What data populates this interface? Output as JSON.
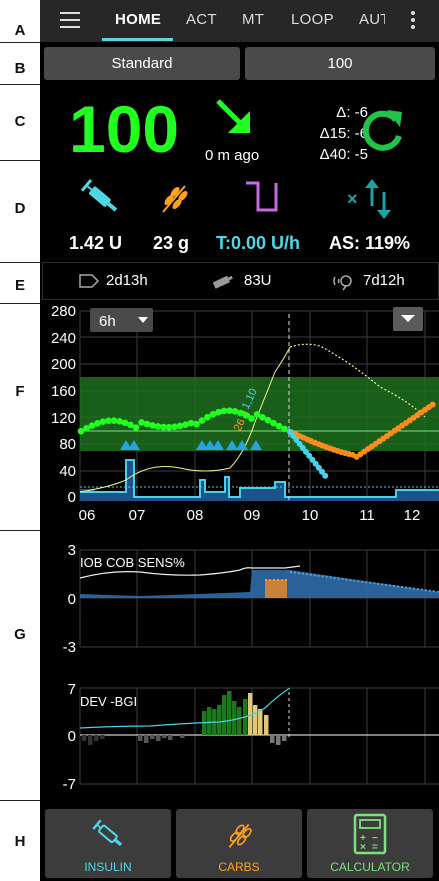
{
  "annotations": [
    "A",
    "B",
    "C",
    "D",
    "E",
    "F",
    "G",
    "H"
  ],
  "nav": {
    "tabs": [
      {
        "label": "HOME",
        "active": true
      },
      {
        "label": "ACT"
      },
      {
        "label": "MT"
      },
      {
        "label": "LOOP"
      },
      {
        "label": "AUT"
      }
    ],
    "menu_icon": "hamburger-icon",
    "overflow_icon": "more-vertical-icon"
  },
  "profile": {
    "name": "Standard",
    "target": "100"
  },
  "bg": {
    "value": "100",
    "trend_icon": "arrow-down-right-icon",
    "time_ago": "0 m ago",
    "delta": "Δ: -6",
    "delta15": "Δ15: -6",
    "delta40": "Δ40: -5",
    "refresh_icon": "refresh-icon",
    "color": "#21ff21"
  },
  "status": {
    "insulin": "1.42 U",
    "carbs": "23 g",
    "temp_basal": "T:0.00 U/h",
    "autosens": "AS: 119%",
    "icons": [
      "syringe-icon",
      "wheat-icon",
      "temp-basal-icon",
      "autosens-icon"
    ],
    "colors": {
      "insulin": "#4fd6e6",
      "carbs": "#ffa21a",
      "basal": "#c46be0",
      "autosens": "#19a5a5"
    }
  },
  "devices": {
    "cannula": "2d13h",
    "reservoir": "83U",
    "sensor": "7d12h"
  },
  "main_graph": {
    "range_label": "6h",
    "y_ticks": [
      "280",
      "240",
      "200",
      "160",
      "120",
      "80",
      "40",
      "0"
    ],
    "x_ticks": [
      "06",
      "07",
      "08",
      "09",
      "10",
      "11",
      "12"
    ],
    "annot_iob": "1,10",
    "annot_cob": "26 g"
  },
  "iob_graph": {
    "legend": "IOB COB SENS%",
    "y_ticks": [
      "3",
      "0",
      "-3"
    ]
  },
  "dev_graph": {
    "legend": "DEV -BGI",
    "y_ticks": [
      "7",
      "0",
      "-7"
    ]
  },
  "footer": {
    "insulin": "INSULIN",
    "carbs": "CARBS",
    "calculator": "CALCULATOR",
    "colors": {
      "insulin": "#4fd6e6",
      "carbs": "#ffa21a",
      "calculator": "#7ce07c"
    }
  },
  "chart_data": {
    "type": "line",
    "x": [
      "06:00",
      "06:30",
      "07:00",
      "07:30",
      "08:00",
      "08:30",
      "09:00",
      "09:30",
      "10:00",
      "10:30",
      "11:00",
      "11:30",
      "12:00"
    ],
    "series": [
      {
        "values": [
          100,
          102,
          110,
          130,
          120,
          105,
          120,
          105,
          80,
          70,
          85,
          110,
          130
        ]
      }
    ],
    "ylim": [
      0,
      280
    ],
    "grid": true
  }
}
